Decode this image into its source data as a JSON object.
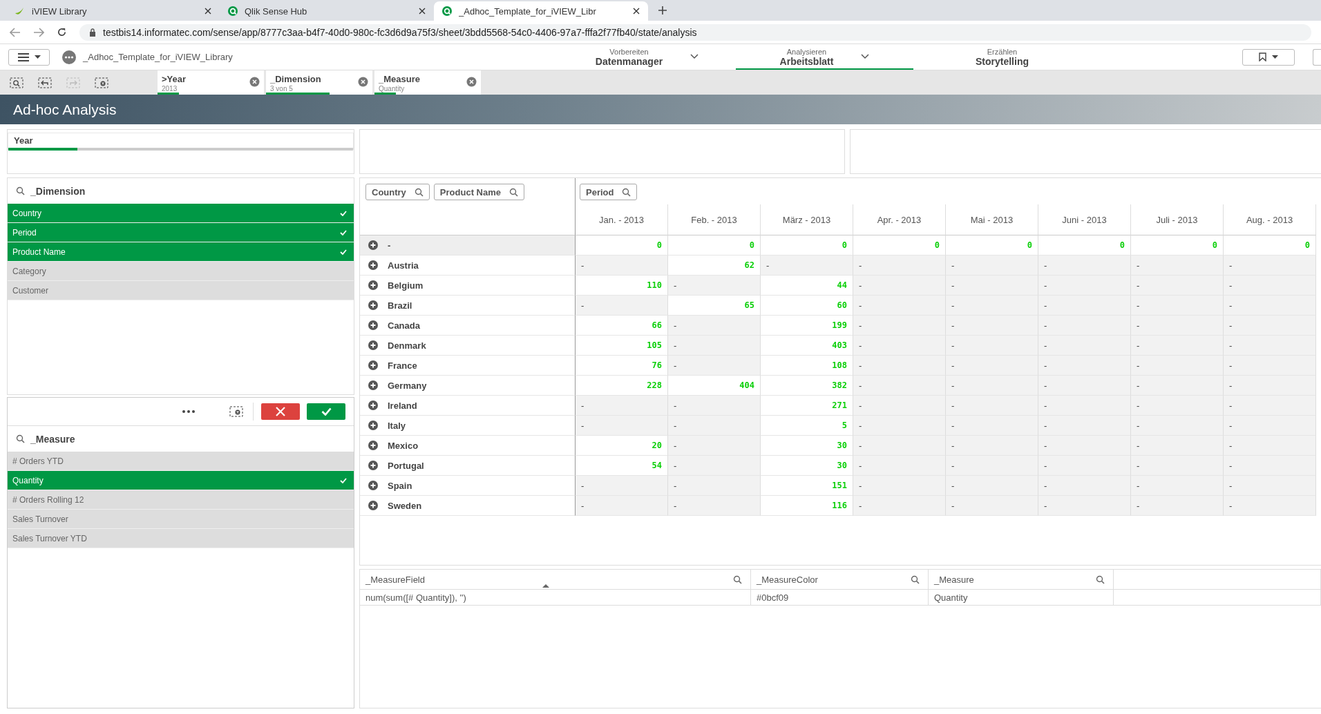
{
  "browser": {
    "tabs": [
      {
        "title": "iVIEW Library",
        "kind": "swoosh",
        "selected": false
      },
      {
        "title": "Qlik Sense Hub",
        "kind": "qlik",
        "selected": false
      },
      {
        "title": "_Adhoc_Template_for_iVIEW_Libr",
        "kind": "qlik",
        "selected": true
      }
    ],
    "url": "testbis14.informatec.com/sense/app/8777c3aa-b4f7-40d0-980c-fc3d6d9a75f3/sheet/3bdd5568-54c0-4406-97a7-fffa2f77fb40/state/analysis"
  },
  "app": {
    "title": "_Adhoc_Template_for_iVIEW_Library",
    "nav": [
      {
        "caption": "Vorbereiten",
        "label": "Datenmanager",
        "dropdown": true,
        "selected": false
      },
      {
        "caption": "Analysieren",
        "label": "Arbeitsblatt",
        "dropdown": true,
        "selected": true
      },
      {
        "caption": "Erzählen",
        "label": "Storytelling",
        "dropdown": false,
        "selected": false
      }
    ]
  },
  "selections": [
    {
      "field": ">Year",
      "value": "2013",
      "level": 0.2
    },
    {
      "field": "_Dimension",
      "value": "3 von 5",
      "level": 0.6
    },
    {
      "field": "_Measure",
      "value": "Quantity",
      "level": 0.2
    }
  ],
  "sheet_title": "Ad-hoc Analysis",
  "year_filter": {
    "label": "Year",
    "level": 0.2
  },
  "dimension": {
    "title": "_Dimension",
    "items": [
      {
        "label": "Country",
        "selected": true
      },
      {
        "label": "Period",
        "selected": true
      },
      {
        "label": "Product Name",
        "selected": true
      },
      {
        "label": "Category",
        "selected": false
      },
      {
        "label": "Customer",
        "selected": false
      }
    ]
  },
  "measure": {
    "title": "_Measure",
    "items": [
      {
        "label": "# Orders YTD",
        "selected": false
      },
      {
        "label": "Quantity",
        "selected": true
      },
      {
        "label": "# Orders Rolling 12",
        "selected": false
      },
      {
        "label": "Sales Turnover",
        "selected": false
      },
      {
        "label": "Sales Turnover YTD",
        "selected": false
      }
    ]
  },
  "pivot": {
    "row_fields": [
      "Country",
      "Product Name"
    ],
    "column_field": "Period",
    "columns": [
      "Jan. - 2013",
      "Feb. - 2013",
      "März - 2013",
      "Apr. - 2013",
      "Mai - 2013",
      "Juni - 2013",
      "Juli - 2013",
      "Aug. - 2013"
    ],
    "rows": [
      {
        "label": "-",
        "values": [
          "0",
          "0",
          "0",
          "0",
          "0",
          "0",
          "0",
          "0"
        ]
      },
      {
        "label": "Austria",
        "values": [
          "-",
          "62",
          "-",
          "-",
          "-",
          "-",
          "-",
          "-"
        ]
      },
      {
        "label": "Belgium",
        "values": [
          "110",
          "-",
          "44",
          "-",
          "-",
          "-",
          "-",
          "-"
        ]
      },
      {
        "label": "Brazil",
        "values": [
          "-",
          "65",
          "60",
          "-",
          "-",
          "-",
          "-",
          "-"
        ]
      },
      {
        "label": "Canada",
        "values": [
          "66",
          "-",
          "199",
          "-",
          "-",
          "-",
          "-",
          "-"
        ]
      },
      {
        "label": "Denmark",
        "values": [
          "105",
          "-",
          "403",
          "-",
          "-",
          "-",
          "-",
          "-"
        ]
      },
      {
        "label": "France",
        "values": [
          "76",
          "-",
          "108",
          "-",
          "-",
          "-",
          "-",
          "-"
        ]
      },
      {
        "label": "Germany",
        "values": [
          "228",
          "404",
          "382",
          "-",
          "-",
          "-",
          "-",
          "-"
        ]
      },
      {
        "label": "Ireland",
        "values": [
          "-",
          "-",
          "271",
          "-",
          "-",
          "-",
          "-",
          "-"
        ]
      },
      {
        "label": "Italy",
        "values": [
          "-",
          "-",
          "5",
          "-",
          "-",
          "-",
          "-",
          "-"
        ]
      },
      {
        "label": "Mexico",
        "values": [
          "20",
          "-",
          "30",
          "-",
          "-",
          "-",
          "-",
          "-"
        ]
      },
      {
        "label": "Portugal",
        "values": [
          "54",
          "-",
          "30",
          "-",
          "-",
          "-",
          "-",
          "-"
        ]
      },
      {
        "label": "Spain",
        "values": [
          "-",
          "-",
          "151",
          "-",
          "-",
          "-",
          "-",
          "-"
        ]
      },
      {
        "label": "Sweden",
        "values": [
          "-",
          "-",
          "116",
          "-",
          "-",
          "-",
          "-",
          "-"
        ]
      }
    ]
  },
  "field_table": {
    "columns": [
      "_MeasureField",
      "_MeasureColor",
      "_Measure"
    ],
    "rows": [
      [
        "num(sum([# Quantity]), '')",
        "#0bcf09",
        "Quantity"
      ]
    ]
  }
}
